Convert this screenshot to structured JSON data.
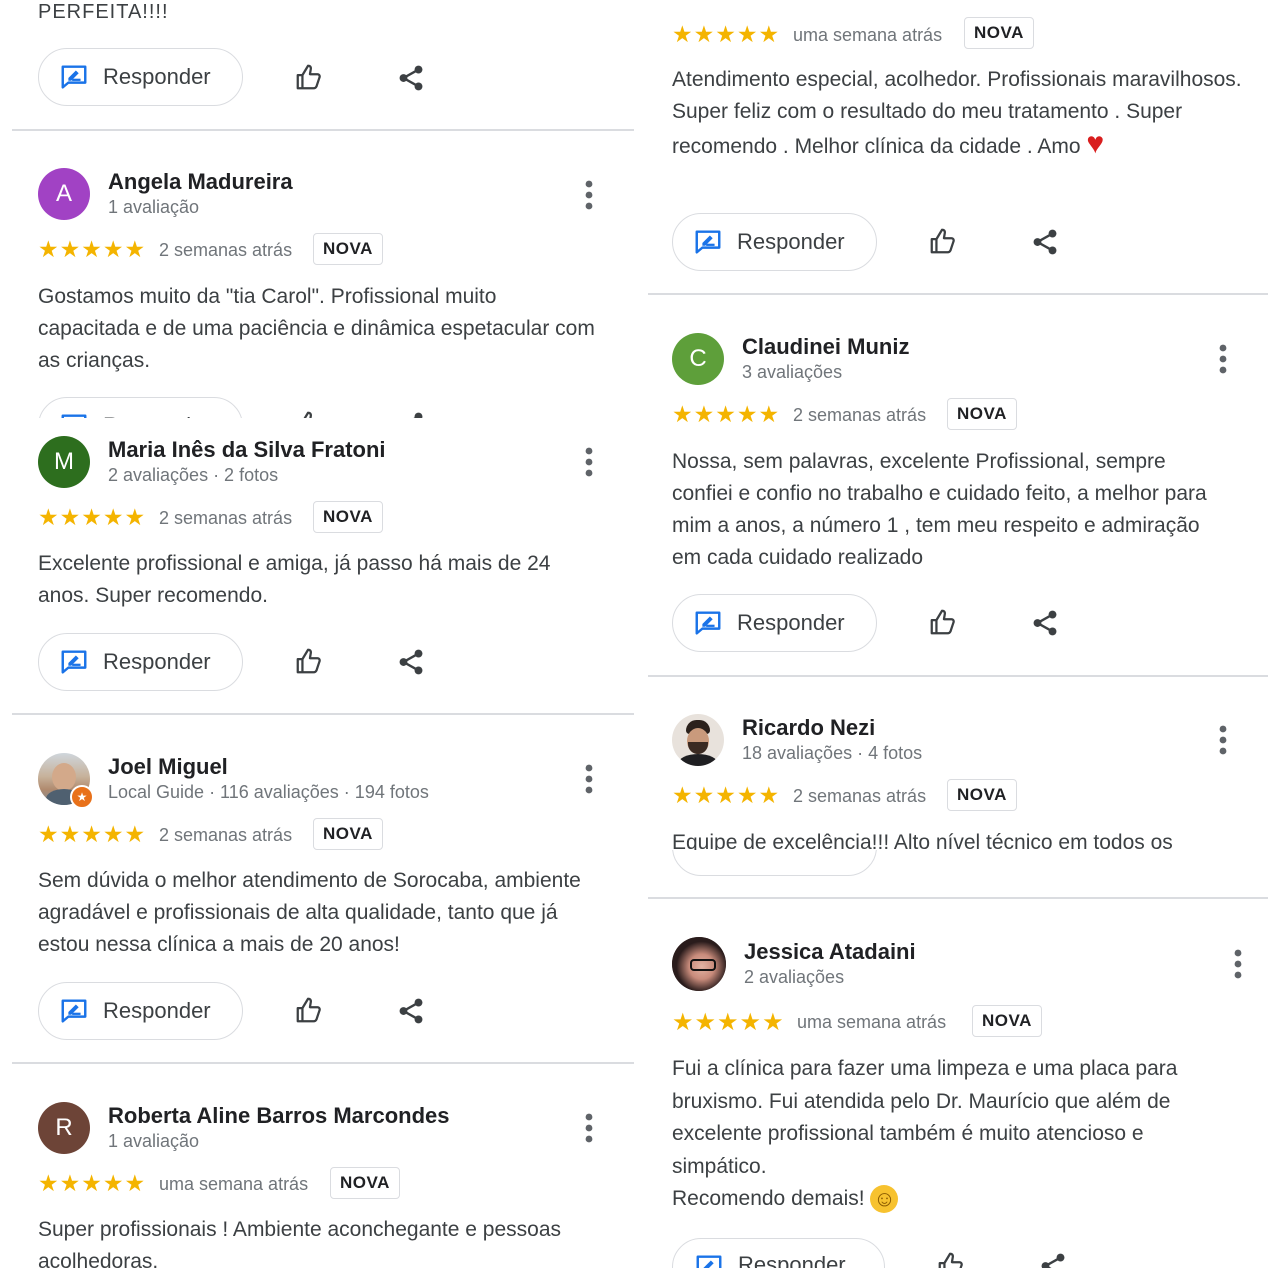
{
  "colors": {
    "star": "#f4b400",
    "divider": "#dadce0",
    "reply_icon": "#1a73e8"
  },
  "ui": {
    "reply_label": "Responder",
    "new_badge": "NOVA",
    "stars": "★★★★★"
  },
  "left": {
    "top_partial_text": "PERFEITA!!!!",
    "reviews": [
      {
        "name": "Angela Madureira",
        "initial": "A",
        "avatar_color": "#a142c4",
        "meta": "1 avaliação",
        "time": "2 semanas atrás",
        "text": "Gostamos muito da \"tia Carol\". Profissional muito capacitada e de uma paciência e dinâmica espetacular com as crianças."
      },
      {
        "name": "Maria Inês da Silva Fratoni",
        "initial": "M",
        "avatar_color": "#2d6e1e",
        "meta": "2 avaliações · 2 fotos",
        "time": "2 semanas atrás",
        "text": "Excelente profissional e amiga, já passo há mais de 24 anos. Super recomendo."
      },
      {
        "name": "Joel Miguel",
        "meta": "Local Guide · 116 avaliações · 194 fotos",
        "time": "2 semanas atrás",
        "text": "Sem dúvida o melhor atendimento de Sorocaba, ambiente agradável e profissionais de alta qualidade, tanto que já estou nessa clínica a mais de 20 anos!"
      },
      {
        "name": "Roberta Aline Barros Marcondes",
        "initial": "R",
        "avatar_color": "#6d4437",
        "meta": "1 avaliação",
        "time": "uma semana atrás",
        "text": "Super profissionais ! Ambiente aconchegante e pessoas acolhedoras."
      }
    ]
  },
  "right": {
    "top": {
      "time": "uma semana atrás",
      "text": "Atendimento especial, acolhedor. Profissionais maravilhosos. Super feliz com o resultado do meu tratamento . Super recomendo . Melhor clínica da cidade . Amo",
      "emoji": "♥"
    },
    "reviews": [
      {
        "name": "Claudinei Muniz",
        "initial": "C",
        "avatar_color": "#5e9f3a",
        "meta": "3 avaliações",
        "time": "2 semanas atrás",
        "text": "Nossa, sem palavras, excelente Profissional, sempre confiei e confio no trabalho e cuidado feito, a melhor para mim a anos, a número 1 , tem meu respeito e admiração em cada cuidado realizado"
      },
      {
        "name": "Ricardo Nezi",
        "meta": "18 avaliações · 4 fotos",
        "time": "2 semanas atrás",
        "text": "Equipe de excelência!!! Alto nível técnico em todos os"
      },
      {
        "name": "Jessica Atadaini",
        "meta": "2 avaliações",
        "time": "uma semana atrás",
        "text": "Fui a clínica para fazer uma limpeza e uma placa para bruxismo. Fui atendida pelo Dr. Maurício que além de excelente profissional também é muito atencioso e simpático.",
        "text2": "Recomendo demais!",
        "emoji": "☺"
      }
    ]
  }
}
